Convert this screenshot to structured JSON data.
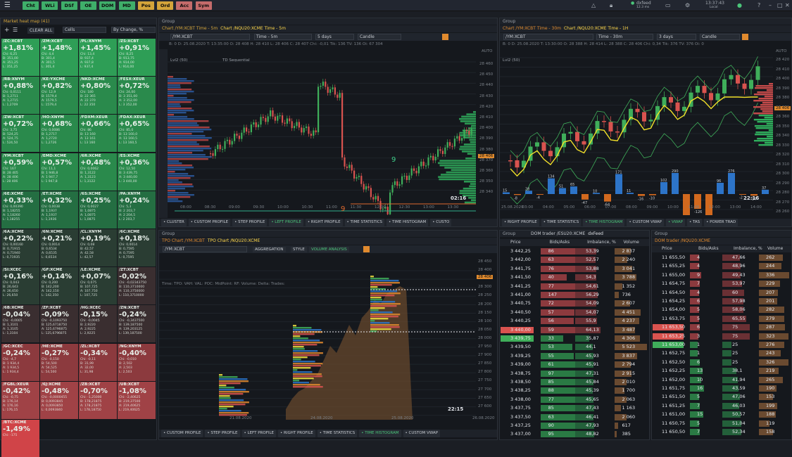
{
  "topbar": {
    "buttons": [
      {
        "label": "Cht",
        "color": "#3fae6a"
      },
      {
        "label": "WLi",
        "color": "#3fae6a"
      },
      {
        "label": "DSf",
        "color": "#3fae6a"
      },
      {
        "label": "OE",
        "color": "#3fae6a"
      },
      {
        "label": "DOM",
        "color": "#3fae6a"
      },
      {
        "label": "MD",
        "color": "#3fae6a"
      },
      {
        "label": "Pos",
        "color": "#d4a43a"
      },
      {
        "label": "Ord",
        "color": "#d4a43a"
      },
      {
        "label": "Acc",
        "color": "#c46b6b"
      },
      {
        "label": "Sym",
        "color": "#c46b6b"
      }
    ],
    "feed": "dxfeed",
    "feed_sub": "12.3 ms",
    "time": "13:37:43",
    "zone": "Local"
  },
  "heatmap": {
    "title": "Market heat map (41)",
    "clear_all": "CLEAR ALL",
    "mode": "Cells",
    "sort": "By Change, %",
    "cells": [
      {
        "sym": "/ZC:XCBT",
        "chg": "+1,81%",
        "d": [
          "Chi: 6,25",
          "B: 351,00",
          "A: 351,25",
          "L: 351,25"
        ],
        "c": "#2e9e56"
      },
      {
        "sym": "/ZM:XCBT",
        "chg": "+1,48%",
        "d": [
          "Chi: 4,4",
          "B: 301,4",
          "A: 301,5",
          "L: 301,4"
        ],
        "c": "#2e9e56"
      },
      {
        "sym": "/PL:XNYM",
        "chg": "+1,45%",
        "d": [
          "Chi: 13,4",
          "B: 937,4",
          "A: 937,8",
          "L: 937,4"
        ],
        "c": "#2e9e56"
      },
      {
        "sym": "/ZS:XCBT",
        "chg": "+0,91%",
        "d": [
          "Chi: 8,25",
          "B: 913,75",
          "A: 914,00",
          "L: 914,00"
        ],
        "c": "#2e9e56"
      },
      {
        "sym": "/RB:XNYM",
        "chg": "+0,88%",
        "d": [
          "Chi: 0,0111",
          "B: 1,2711",
          "A: 1,2715",
          "L: 1,2709"
        ],
        "c": "#2a8a4c"
      },
      {
        "sym": "/KE:YXCME",
        "chg": "+0,82%",
        "d": [
          "Chi: 12,9",
          "B: 1579,4",
          "A: 1579,5",
          "L: 1579,4"
        ],
        "c": "#2a8a4c"
      },
      {
        "sym": "/NKD:XCME",
        "chg": "+0,80%",
        "d": [
          "Chi: 180",
          "B: 22 365",
          "A: 22 370",
          "L: 22 350"
        ],
        "c": "#2a8a4c"
      },
      {
        "sym": "/FESX:XEUR",
        "chg": "+0,72%",
        "d": [
          "Chi: 24,00",
          "B: 3 351,00",
          "A: 3 352,00",
          "L: 3 352,00"
        ],
        "c": "#2a8a4c"
      },
      {
        "sym": "/ZW:XCBT",
        "chg": "+0,72%",
        "d": [
          "Chi: 3,75",
          "B: 524,25",
          "A: 524,75",
          "L: 524,50"
        ],
        "c": "#2a8a4c"
      },
      {
        "sym": "/HO:XNYM",
        "chg": "+0,68%",
        "d": [
          "Chi: 0,0086",
          "B: 1,2717",
          "A: 1,2720",
          "L: 1,2726"
        ],
        "c": "#2a8a4c"
      },
      {
        "sym": "/FDXM:XEUR",
        "chg": "+0,66%",
        "d": [
          "Chi: 86",
          "B: 13 160",
          "A: 13 161",
          "L: 13 160"
        ],
        "c": "#2a8a4c"
      },
      {
        "sym": "/FDAX:XEUR",
        "chg": "+0,65%",
        "d": [
          "Chi: 85,0",
          "B: 13 160,0",
          "A: 13 160,5",
          "L: 13 160,5"
        ],
        "c": "#2a8a4c"
      },
      {
        "sym": "/YM:XCBT",
        "chg": "+0,59%",
        "d": [
          "Chi: 167",
          "B: 28 405",
          "A: 28 406",
          "L: 28 406"
        ],
        "c": "#2a8a4c"
      },
      {
        "sym": "/EMD:XCME",
        "chg": "+0,57%",
        "d": [
          "Chi: 11,1",
          "B: 1 946,8",
          "A: 1 947,7",
          "L: 1 947,8"
        ],
        "c": "#2a8a4c"
      },
      {
        "sym": "/6R:XCME",
        "chg": "+0,48%",
        "d": [
          "Chi: 0,0062",
          "B: 1,3122",
          "A: 1,3123",
          "L: 1,3122"
        ],
        "c": "#2a8a4c"
      },
      {
        "sym": "/ES:XCME",
        "chg": "+0,36%",
        "d": [
          "Chi: 12,50",
          "B: 3 439,75",
          "A: 3 440,00",
          "L: 3 440,00"
        ],
        "c": "#2a8a4c"
      },
      {
        "sym": "/6E:XCME",
        "chg": "+0,33%",
        "d": [
          "Chi: 0,00390",
          "B: 1,18255",
          "A: 1,18260",
          "L: 1,18255"
        ],
        "c": "#246e42"
      },
      {
        "sym": "/ET:XCME",
        "chg": "+0,32%",
        "d": [
          "Chi: 0,0038",
          "B: 1,1937",
          "A: 1,1937",
          "L: 1,1936"
        ],
        "c": "#246e42"
      },
      {
        "sym": "/6S:XCME",
        "chg": "+0,25%",
        "d": [
          "Chi: 0,0027",
          "B: 1,0875",
          "A: 1,0875",
          "L: 1,0875"
        ],
        "c": "#246e42"
      },
      {
        "sym": "/PA:XNYM",
        "chg": "+0,24%",
        "d": [
          "Chi: 5,3",
          "B: 2 203,7",
          "A: 2 204,5",
          "L: 2 203,7"
        ],
        "c": "#246e42"
      },
      {
        "sym": "/6A:XCME",
        "chg": "+0,22%",
        "d": [
          "Chi: 0,00160",
          "B: 0,71915",
          "A: 0,71940",
          "L: 0,71935"
        ],
        "c": "#2a3d33"
      },
      {
        "sym": "/6N:XCME",
        "chg": "+0,21%",
        "d": [
          "Chi: 0,0014",
          "B: 0,6534",
          "A: 0,6535",
          "L: 0,6534"
        ],
        "c": "#2a3d33"
      },
      {
        "sym": "/CL:XNYM",
        "chg": "+0,19%",
        "d": [
          "Chi: 0,08",
          "B: 42,57",
          "A: 42,58",
          "L: 42,57"
        ],
        "c": "#2a3d33"
      },
      {
        "sym": "/6C:XCME",
        "chg": "+0,18%",
        "d": [
          "Chi: 0,0014",
          "B: 0,7595",
          "A: 0,7595",
          "L: 0,7595"
        ],
        "c": "#2a3d33"
      },
      {
        "sym": "/SI:XCEC",
        "chg": "+0,16%",
        "d": [
          "Chi: 0,043",
          "B: 26,643",
          "A: 26,650",
          "L: 26,650"
        ],
        "c": "#2a3d33"
      },
      {
        "sym": "/GF:XCME",
        "chg": "+0,14%",
        "d": [
          "Chi: 0,200",
          "B: 142,200",
          "A: 142,150",
          "L: 142,350"
        ],
        "c": "#2a3d33"
      },
      {
        "sym": "/LE:XCME",
        "chg": "+0,07%",
        "d": [
          "Chi: 0,075",
          "B: 107,725",
          "A: 107,750",
          "L: 107,725"
        ],
        "c": "#2a3d33"
      },
      {
        "sym": "/ZT:XCBT",
        "chg": "-0,02%",
        "d": [
          "Chi: -0,02343750",
          "B: 110,3710000",
          "A: 110,3750000",
          "L: 110,3710000"
        ],
        "c": "#3a2e30"
      },
      {
        "sym": "/6B:XCME",
        "chg": "-0,04%",
        "d": [
          "Chi: -0,0005",
          "B: 1,3101",
          "A: 1,3105",
          "L: 1,3104"
        ],
        "c": "#3a2e30"
      },
      {
        "sym": "/ZF:XCBT",
        "chg": "-0,09%",
        "d": [
          "Chi: -0,1093750",
          "B: 125,6718750",
          "A: 125,6796875",
          "L: 125,6796875"
        ],
        "c": "#3a2e30"
      },
      {
        "sym": "/HG:XCEC",
        "chg": "-0,15%",
        "d": [
          "Chi: -0,0045",
          "B: 2,9220",
          "A: 2,9225",
          "L: 2,9225"
        ],
        "c": "#3a2e30"
      },
      {
        "sym": "/ZN:XCBT",
        "chg": "-0,24%",
        "d": [
          "Chi: -0,3437500",
          "B: 139,187500",
          "A: 139,203125",
          "L: 139,187500"
        ],
        "c": "#3a2e30"
      },
      {
        "sym": "/GC:XCEC",
        "chg": "-0,24%",
        "d": [
          "Chi: -4,7",
          "B: 1 934,4",
          "A: 1 934,5",
          "L: 1 934,4"
        ],
        "c": "#8c3a3e"
      },
      {
        "sym": "/HE:XCME",
        "chg": "-0,27%",
        "d": [
          "Chi: -0,150",
          "B: 54,500",
          "A: 54,525",
          "L: 54,500"
        ],
        "c": "#8c3a3e"
      },
      {
        "sym": "/ZL:XCBT",
        "chg": "-0,34%",
        "d": [
          "Chi: -0,11",
          "B: 31,99",
          "A: 32,00",
          "L: 31,98"
        ],
        "c": "#8c3a3e"
      },
      {
        "sym": "/NG:XNYM",
        "chg": "-0,40%",
        "d": [
          "Chi: -0,010",
          "B: 2,502",
          "A: 2,503",
          "L: 2,503"
        ],
        "c": "#8c3a3e"
      },
      {
        "sym": "/FGBL:XEUR",
        "chg": "-0,42%",
        "d": [
          "Chi: -0,75",
          "B: 176,14",
          "A: 176,16",
          "L: 176,15"
        ],
        "c": "#a04246"
      },
      {
        "sym": "/6J:XCME",
        "chg": "-0,48%",
        "d": [
          "Chi: -0,0000455",
          "B: 0,0093845",
          "A: 0,0093850",
          "L: 0,0093840"
        ],
        "c": "#a04246"
      },
      {
        "sym": "/ZB:XCBT",
        "chg": "-0,70%",
        "d": [
          "Chi: -1,25000",
          "B: 178,21875",
          "A: 178,21875",
          "L: 178,18750"
        ],
        "c": "#a04246"
      },
      {
        "sym": "/UB:XCBT",
        "chg": "-1,08%",
        "d": [
          "Chi: -2,40625",
          "B: 219,37500",
          "A: 219,40625",
          "L: 219,40625"
        ],
        "c": "#a04246"
      },
      {
        "sym": "/BTC:XCME",
        "chg": "-1,49%",
        "d": [
          "Chi: -175"
        ],
        "c": "#d04448"
      }
    ]
  },
  "chart1": {
    "group": "Group",
    "tab1": "Chart /YM:XCBT Time - 5m",
    "tab2": "Chart /NQU20:XCME Time - 5m",
    "symbol": "/YM:XCBT",
    "feed": "DxFeed",
    "period": "Time - 5m",
    "range": "5 days",
    "type": "Candle",
    "ohlc": "B: 0   D: 25.08.2020   T: 13:35:00   O: 28 408   H: 28 410   L: 28 406   C: 28 407   Chi: -0,01   Tik: 136   TV: 136   Oi: 67 304",
    "ind1": "Lvl2 (50)",
    "ind2": "TD Sequential",
    "timer": "02:16",
    "price_tag": "28 406",
    "auto": "AUTO",
    "yticks": [
      "28 460",
      "28 450",
      "28 440",
      "28 430",
      "28 420",
      "28 410",
      "28 400",
      "28 390",
      "28 380",
      "28 370",
      "28 360",
      "28 350",
      "28 340"
    ],
    "xticks": [
      "08:00",
      "08:30",
      "09:00",
      "09:30",
      "10:00",
      "10:30",
      "11:00",
      "11:30",
      "12:00",
      "12:30",
      "13:00",
      "13:30"
    ],
    "buttons": [
      "CLUSTER",
      "CUSTOM PROFILE",
      "STEP PROFILE",
      "LEFT PROFILE",
      "RIGHT PROFILE",
      "TIME STATISTICS",
      "TIME HISTOGRAM",
      "CUSTO"
    ]
  },
  "chart2": {
    "group": "Group",
    "tab1": "Chart /YM:XCBT Time - 30m",
    "tab2": "Chart /NQU20:XCME Time - 1H",
    "symbol": "/YM:XCBT",
    "feed": "DxFeed",
    "period": "Time - 30m",
    "range": "3 days",
    "type": "Candle",
    "ohlc": "B: 0   D: 25.08.2020   T: 13:30:00   O: 28 388   H: 28 414   L: 28 388   C: 28 406   Chi: 0,34   Tik: 376   TV: 376   Oi: 0",
    "ind1": "Lvl2 (50)",
    "timer": "22:16",
    "price_tag": "28 406",
    "auto": "AUTO",
    "yticks": [
      "28 420",
      "28 410",
      "28 400",
      "28 390",
      "28 380",
      "28 370",
      "28 360",
      "28 350",
      "28 340",
      "28 330",
      "28 320",
      "28 310",
      "28 300",
      "28 290",
      "28 280",
      "28 270",
      "28 260"
    ],
    "xticks": [
      "25.08.2020",
      "03:00",
      "04:00",
      "05:00",
      "06:00",
      "07:00",
      "08:00",
      "09:00",
      "10:00",
      "11:00",
      "12:00",
      "13:00",
      "14:00"
    ],
    "hist": [
      "15",
      "-8",
      "28",
      "-4",
      "134",
      "51",
      "65",
      "-47",
      "10",
      "-64",
      "171",
      "11",
      "-16",
      "-10",
      "102",
      "290",
      "-216",
      "-126",
      "-219",
      "96",
      "276",
      "-2",
      "-14",
      "37"
    ],
    "buttons": [
      "RIGHT PROFILE",
      "TIME STATISTICS",
      "TIME HISTOGRAM",
      "CUSTOM VWAP",
      "VWAP",
      "TAS",
      "POWER TRAD"
    ]
  },
  "tpo": {
    "group": "Group",
    "tab1": "TPO Chart /YM:XCBT",
    "tab2": "TPO Chart /NQU20:XCME",
    "symbol": "/YM:XCBT",
    "feed": "DxFeed",
    "aggr": "AGGREGATION",
    "style": "STYLE",
    "volume": "VOLUME ANALYSIS",
    "stats": "Time:   TPO:   VAH:   VAL:   POC:   MidPoint:   RF:   Volume:   Delta:   Trades:",
    "timer": "22:15",
    "price_tag": "28 406",
    "yticks": [
      "28 450",
      "28 400",
      "28 350",
      "28 300",
      "28 250",
      "28 200",
      "28 150",
      "28 100",
      "28 050",
      "28 000",
      "27 950",
      "27 900",
      "27 850",
      "27 800",
      "27 750",
      "27 700",
      "27 650",
      "27 600"
    ],
    "xticks": [
      "21.08.2020",
      "24.08.2020",
      "25.08.2020",
      "26.08.2020"
    ],
    "buttons": [
      "CUSTOM PROFILE",
      "STEP PROFILE",
      "LEFT PROFILE",
      "RIGHT PROFILE",
      "TIME STATISTICS",
      "TIME HISTOGRAM",
      "CUSTOM VWAP"
    ]
  },
  "dom1": {
    "group": "Group",
    "tab": "DOM trader /ESU20:XCME",
    "feed": "dxFeed",
    "feed2": "Data power",
    "headers": [
      "Price",
      "Bids/Asks",
      "Imbalance, %",
      "Volume"
    ],
    "rows": [
      [
        "3 442,25",
        "86",
        "53,39",
        "2 837",
        "a"
      ],
      [
        "3 442,00",
        "63",
        "52,57",
        "2 240",
        "a"
      ],
      [
        "3 441,75",
        "76",
        "53,88",
        "3 041",
        "a"
      ],
      [
        "3 441,50",
        "40",
        "54,3",
        "3 788",
        "a"
      ],
      [
        "3 441,25",
        "77",
        "54,61",
        "1 352",
        "a"
      ],
      [
        "3 441,00",
        "147",
        "56,29",
        "736",
        "a"
      ],
      [
        "3 440,75",
        "72",
        "54,09",
        "2 607",
        "a"
      ],
      [
        "3 440,50",
        "57",
        "54,07",
        "4 451",
        "a"
      ],
      [
        "3 440,25",
        "56",
        "55,9",
        "4 237",
        "a"
      ],
      [
        "3 440,00",
        "59",
        "64,13",
        "3 487",
        "A"
      ],
      [
        "3 439,75",
        "33",
        "35,87",
        "4 306",
        "B"
      ],
      [
        "3 439,50",
        "53",
        "44,1",
        "5 523",
        "b"
      ],
      [
        "3 439,25",
        "55",
        "45,93",
        "3 837",
        "b"
      ],
      [
        "3 439,00",
        "61",
        "45,91",
        "2 794",
        "b"
      ],
      [
        "3 438,75",
        "97",
        "47,31",
        "2 915",
        "b"
      ],
      [
        "3 438,50",
        "85",
        "45,84",
        "2 010",
        "b"
      ],
      [
        "3 438,25",
        "88",
        "45,39",
        "1 700",
        "b"
      ],
      [
        "3 438,00",
        "77",
        "45,65",
        "2 063",
        "b"
      ],
      [
        "3 437,75",
        "85",
        "47,43",
        "1 163",
        "b"
      ],
      [
        "3 437,50",
        "63",
        "46,41",
        "2 060",
        "b"
      ],
      [
        "3 437,25",
        "90",
        "47,93",
        "617",
        "b"
      ],
      [
        "3 437,00",
        "95",
        "48,82",
        "385",
        "b"
      ]
    ]
  },
  "dom2": {
    "group": "Group",
    "tab": "DOM trader /NQU20:XCME",
    "headers": [
      "Price",
      "Bids/Asks",
      "Imbalance, %",
      "Volume"
    ],
    "rows": [
      [
        "11 655,50",
        "4",
        "47,66",
        "262",
        "a"
      ],
      [
        "11 655,25",
        "4",
        "48,96",
        "244",
        "a"
      ],
      [
        "11 655,00",
        "9",
        "49,43",
        "336",
        "a"
      ],
      [
        "11 654,75",
        "7",
        "53,97",
        "229",
        "a"
      ],
      [
        "11 654,50",
        "4",
        "60",
        "207",
        "a"
      ],
      [
        "11 654,25",
        "6",
        "57,98",
        "201",
        "a"
      ],
      [
        "11 654,00",
        "5",
        "58,06",
        "282",
        "a"
      ],
      [
        "11 653,75",
        "5",
        "65,55",
        "279",
        "a"
      ],
      [
        "11 653,50",
        "6",
        "75",
        "287",
        "A"
      ],
      [
        "11 653,25",
        "3",
        "75",
        "323",
        "A"
      ],
      [
        "11 653,00",
        "1",
        "25",
        "276",
        "B"
      ],
      [
        "11 652,75",
        "1",
        "25",
        "243",
        "b"
      ],
      [
        "11 652,50",
        "6",
        "25",
        "326",
        "b"
      ],
      [
        "11 652,25",
        "13",
        "38,1",
        "219",
        "b"
      ],
      [
        "11 652,00",
        "10",
        "41,94",
        "265",
        "b"
      ],
      [
        "11 651,75",
        "16",
        "43,59",
        "190",
        "b"
      ],
      [
        "11 651,50",
        "5",
        "47,06",
        "153",
        "b"
      ],
      [
        "11 651,25",
        "7",
        "46,03",
        "199",
        "b"
      ],
      [
        "11 651,00",
        "15",
        "50,57",
        "188",
        "b"
      ],
      [
        "11 650,75",
        "5",
        "51,04",
        "119",
        "b"
      ],
      [
        "11 650,50",
        "7",
        "52,34",
        "158",
        "b"
      ]
    ]
  },
  "colors": {
    "bull": "#3fae5a",
    "bear": "#d9534f",
    "accent": "#e08a2e"
  }
}
